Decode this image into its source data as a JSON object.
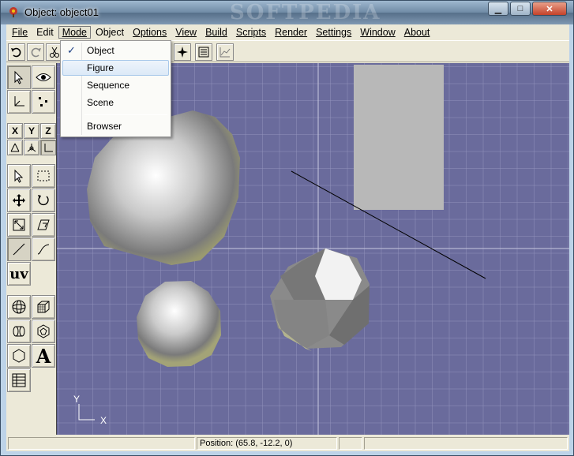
{
  "window": {
    "title": "Object: object01",
    "watermark": "SOFTPEDIA",
    "buttons": {
      "minimize": "▁",
      "maximize": "□",
      "close": "✕"
    }
  },
  "menubar": {
    "items": [
      {
        "label": "File"
      },
      {
        "label": "Edit"
      },
      {
        "label": "Mode"
      },
      {
        "label": "Object"
      },
      {
        "label": "Options"
      },
      {
        "label": "View"
      },
      {
        "label": "Build"
      },
      {
        "label": "Scripts"
      },
      {
        "label": "Render"
      },
      {
        "label": "Settings"
      },
      {
        "label": "Window"
      },
      {
        "label": "About"
      }
    ],
    "active": "Mode"
  },
  "mode_menu": {
    "items": [
      {
        "label": "Object",
        "checked": true
      },
      {
        "label": "Figure",
        "hover": true
      },
      {
        "label": "Sequence"
      },
      {
        "label": "Scene"
      },
      {
        "label": "Browser"
      }
    ]
  },
  "toolbar": {
    "icons": [
      "undo-icon",
      "redo-icon",
      "cut-icon",
      "sparkle-icon",
      "list-icon",
      "graph-icon"
    ]
  },
  "palette": {
    "axis_labels": [
      "X",
      "Y",
      "Z"
    ],
    "uv_label": "uv",
    "text_tool_label": "A"
  },
  "viewport": {
    "axis_y_label": "Y",
    "axis_x_label": "X",
    "background_color": "#6a6b9c"
  },
  "statusbar": {
    "position_text": "Position: (65.8, -12.2, 0)"
  }
}
